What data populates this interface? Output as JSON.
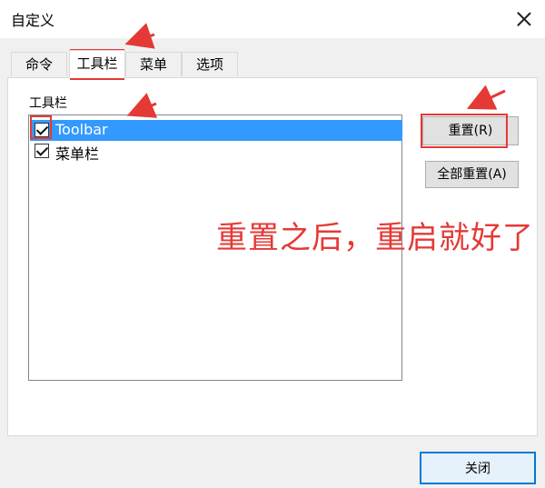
{
  "window": {
    "title": "自定义"
  },
  "tabs": [
    {
      "label": "命令",
      "active": false
    },
    {
      "label": "工具栏",
      "active": true
    },
    {
      "label": "菜单",
      "active": false
    },
    {
      "label": "选项",
      "active": false
    }
  ],
  "toolbars_group": {
    "label": "工具栏",
    "items": [
      {
        "label": "Toolbar",
        "checked": true,
        "selected": true
      },
      {
        "label": "菜单栏",
        "checked": true,
        "selected": false
      }
    ]
  },
  "buttons": {
    "reset": "重置(R)",
    "reset_all": "全部重置(A)",
    "close": "关闭"
  },
  "annotation": {
    "text": "重置之后，重启就好了",
    "color": "#e53935"
  },
  "colors": {
    "selection": "#3399ff",
    "accent": "#0078d7"
  }
}
